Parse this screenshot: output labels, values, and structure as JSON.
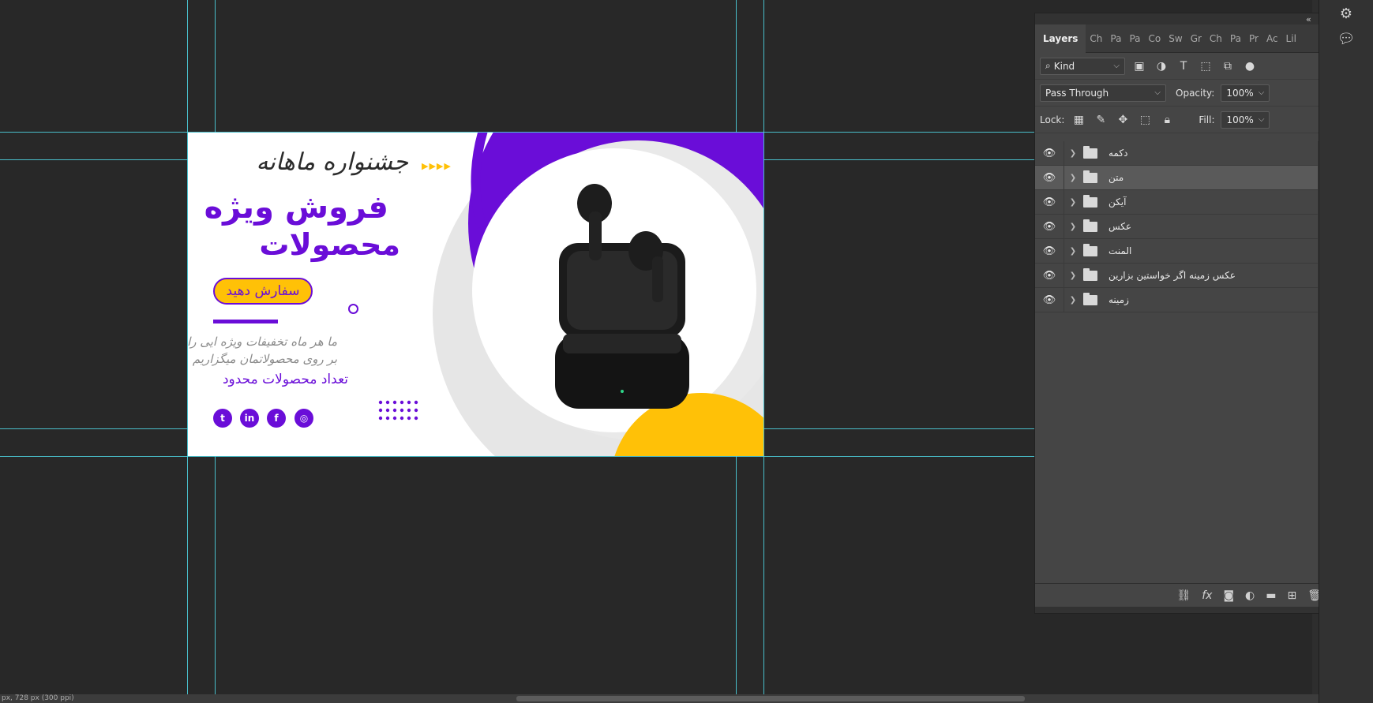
{
  "status_text": "px, 728 px (300 ppi)",
  "banner": {
    "festival_title": "جشنواره ماهانه",
    "headline_line1": "فروش ویژه",
    "headline_line2": "محصولات",
    "order_button": "سفارش دهید",
    "description_line1": "ما هر ماه تخفیفات ویژه ایی را",
    "description_line2": "بر روی محصولاتمان میگزاریم",
    "limited_note": "تعداد محصولات محدود",
    "arrows": "▶▶▶▶",
    "social": [
      "t",
      "in",
      "f",
      "◎"
    ],
    "colors": {
      "purple": "#6a0dd8",
      "yellow": "#ffc107"
    }
  },
  "layers_panel": {
    "tabs": [
      "Layers",
      "Ch",
      "Pa",
      "Pa",
      "Co",
      "Sw",
      "Gr",
      "Ch",
      "Pa",
      "Pr",
      "Ac",
      "Lil"
    ],
    "filter_kind": "Kind",
    "blend_mode": "Pass Through",
    "opacity_label": "Opacity:",
    "opacity_value": "100%",
    "lock_label": "Lock:",
    "fill_label": "Fill:",
    "fill_value": "100%",
    "layers": [
      {
        "name": "دکمه",
        "selected": false
      },
      {
        "name": "متن",
        "selected": true
      },
      {
        "name": "آیکن",
        "selected": false
      },
      {
        "name": "عکس",
        "selected": false
      },
      {
        "name": "المنت",
        "selected": false
      },
      {
        "name": "عکس زمینه اگر خواستین بزارین",
        "selected": false
      },
      {
        "name": "زمینه",
        "selected": false
      }
    ]
  }
}
